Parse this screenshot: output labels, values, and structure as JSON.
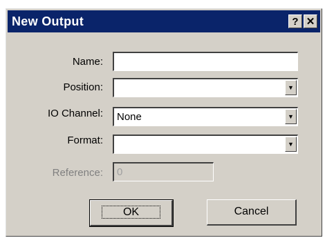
{
  "dialog": {
    "title": "New Output",
    "help_glyph": "?",
    "close_glyph": "✕"
  },
  "fields": {
    "name": {
      "label": "Name:",
      "value": ""
    },
    "position": {
      "label": "Position:",
      "value": ""
    },
    "io_channel": {
      "label": "IO Channel:",
      "value": "None"
    },
    "format": {
      "label": "Format:",
      "value": ""
    },
    "reference": {
      "label": "Reference:",
      "value": "0"
    }
  },
  "buttons": {
    "ok": "OK",
    "cancel": "Cancel"
  },
  "icons": {
    "dropdown": "▼"
  },
  "colors": {
    "titlebar": "#0a246a",
    "dialog_face": "#d4d0c8"
  }
}
